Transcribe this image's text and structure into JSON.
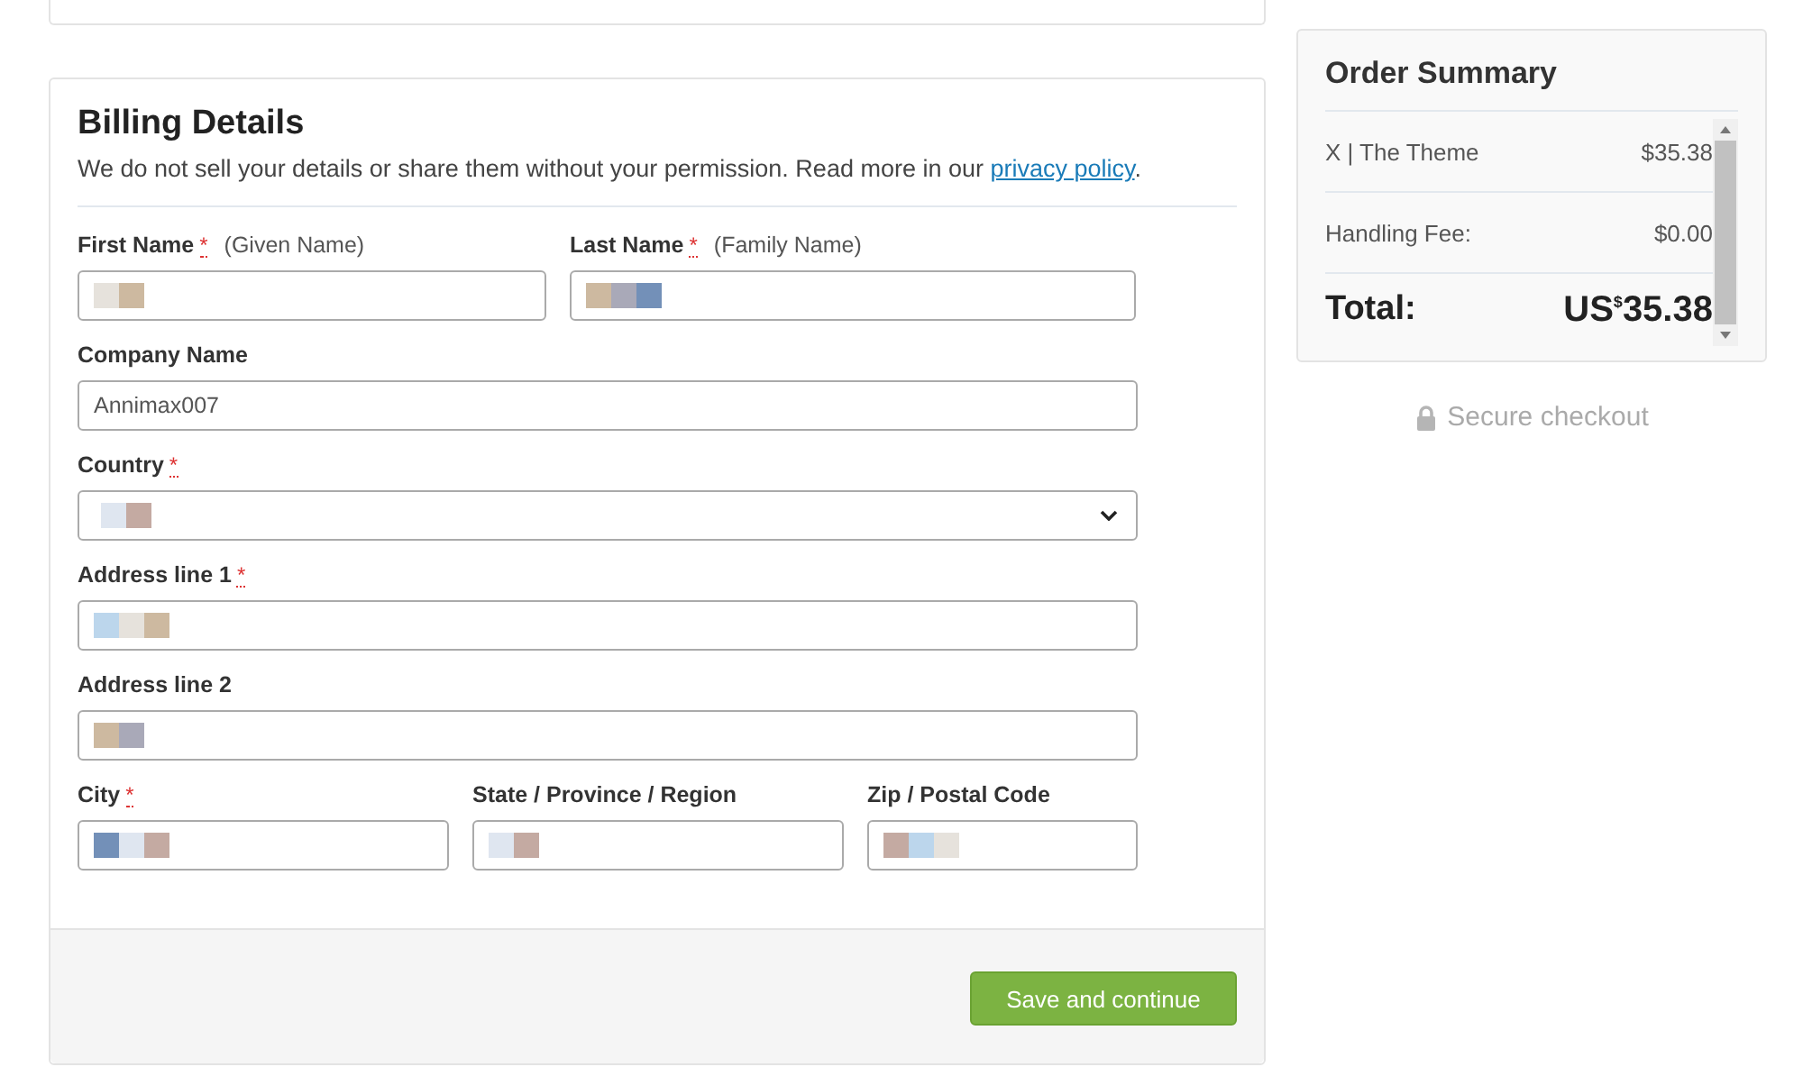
{
  "billing": {
    "title": "Billing Details",
    "notice": "We do not sell your details or share them without your permission. Read more in our ",
    "notice_link": "privacy policy",
    "notice_end": ".",
    "rows": [
      [
        {
          "label": "First Name",
          "required_mark": "*",
          "hint": "(Given Name)",
          "kind": "text",
          "redacted": true
        },
        {
          "label": "Last Name",
          "required_mark": "*",
          "hint": "(Family Name)",
          "kind": "text",
          "redacted": true
        }
      ],
      [
        {
          "label": "Company Name",
          "kind": "text",
          "value": "Annimax007"
        }
      ],
      [
        {
          "label": "Country",
          "required_mark": "*",
          "kind": "select",
          "redacted": true
        }
      ],
      [
        {
          "label": "Address line 1",
          "required_mark": "*",
          "kind": "text",
          "redacted": true
        }
      ],
      [
        {
          "label": "Address line 2",
          "kind": "text",
          "redacted": true
        }
      ],
      [
        {
          "label": "City",
          "required_mark": "*",
          "kind": "text",
          "redacted": true
        },
        {
          "label": "State / Province / Region",
          "kind": "text",
          "redacted": true
        },
        {
          "label": "Zip / Postal Code",
          "kind": "text",
          "redacted": true
        }
      ]
    ],
    "button": "Save and continue"
  },
  "summary": {
    "title": "Order Summary",
    "items": [
      {
        "name": "X | The Theme",
        "price": "$35.38"
      },
      {
        "name": "Handling Fee:",
        "price": "$0.00"
      }
    ],
    "total_label": "Total:",
    "total_currency": "US",
    "total_symbol": "$",
    "total_amount": "35.38"
  },
  "secure": "Secure checkout"
}
